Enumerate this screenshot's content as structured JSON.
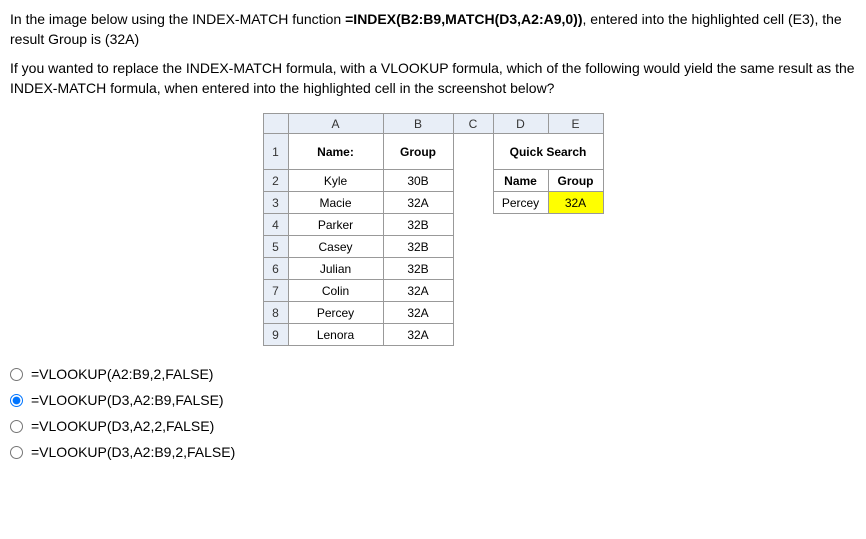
{
  "question": {
    "p1_prefix": "In the image below using the INDEX-MATCH function ",
    "p1_bold": "=INDEX(B2:B9,MATCH(D3,A2:A9,0))",
    "p1_suffix": ", entered into the highlighted cell (E3), the result Group is (32A)",
    "p2": "If you wanted to replace the INDEX-MATCH formula, with a VLOOKUP formula, which of the following would yield the same result as the INDEX-MATCH formula, when entered into the highlighted cell in the screenshot below?"
  },
  "columns": [
    "A",
    "B",
    "C",
    "D",
    "E"
  ],
  "rows": [
    "1",
    "2",
    "3",
    "4",
    "5",
    "6",
    "7",
    "8",
    "9"
  ],
  "table": {
    "A1": "Name:",
    "B1": "Group",
    "A2": "Kyle",
    "B2": "30B",
    "A3": "Macie",
    "B3": "32A",
    "A4": "Parker",
    "B4": "32B",
    "A5": "Casey",
    "B5": "32B",
    "A6": "Julian",
    "B6": "32B",
    "A7": "Colin",
    "B7": "32A",
    "A8": "Percey",
    "B8": "32A",
    "A9": "Lenora",
    "B9": "32A"
  },
  "quicksearch": {
    "title": "Quick Search",
    "name_header": "Name",
    "group_header": "Group",
    "name_value": "Percey",
    "group_value": "32A"
  },
  "options": [
    {
      "id": "opt1",
      "label": "=VLOOKUP(A2:B9,2,FALSE)",
      "checked": false
    },
    {
      "id": "opt2",
      "label": "=VLOOKUP(D3,A2:B9,FALSE)",
      "checked": true
    },
    {
      "id": "opt3",
      "label": "=VLOOKUP(D3,A2,2,FALSE)",
      "checked": false
    },
    {
      "id": "opt4",
      "label": "=VLOOKUP(D3,A2:B9,2,FALSE)",
      "checked": false
    }
  ]
}
